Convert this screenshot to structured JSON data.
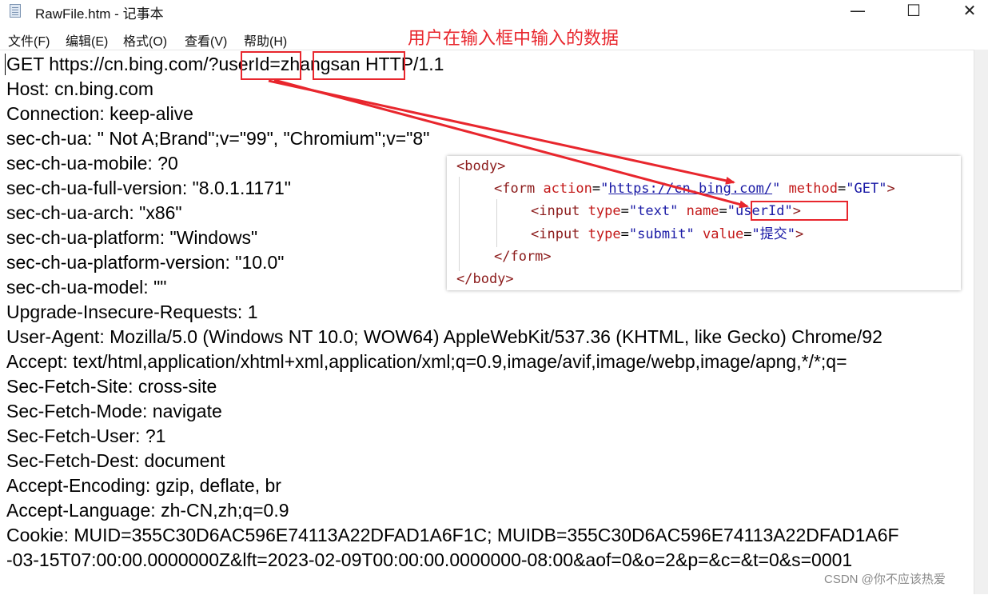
{
  "window": {
    "title": "RawFile.htm - 记事本",
    "controls": {
      "minimize": "—",
      "maximize": "☐",
      "close": "✕"
    }
  },
  "menu": [
    "文件(F)",
    "编辑(E)",
    "格式(O)",
    "查看(V)",
    "帮助(H)"
  ],
  "annotation": "用户在输入框中输入的数据",
  "request": {
    "first_line": {
      "prefix": "GET https://cn.bing.com/?",
      "param_name": "userId",
      "equals": "=",
      "param_value": "zhangsan",
      "suffix": " HTTP/1.1"
    },
    "lines": [
      "Host: cn.bing.com",
      "Connection: keep-alive",
      "sec-ch-ua: \" Not A;Brand\";v=\"99\", \"Chromium\";v=\"8\"",
      "sec-ch-ua-mobile: ?0",
      "sec-ch-ua-full-version: \"8.0.1.1171\"",
      "sec-ch-ua-arch: \"x86\"",
      "sec-ch-ua-platform: \"Windows\"",
      "sec-ch-ua-platform-version: \"10.0\"",
      "sec-ch-ua-model: \"\"",
      "Upgrade-Insecure-Requests: 1",
      "User-Agent: Mozilla/5.0 (Windows NT 10.0; WOW64) AppleWebKit/537.36 (KHTML, like Gecko) Chrome/92",
      "Accept: text/html,application/xhtml+xml,application/xml;q=0.9,image/avif,image/webp,image/apng,*/*;q=",
      "Sec-Fetch-Site: cross-site",
      "Sec-Fetch-Mode: navigate",
      "Sec-Fetch-User: ?1",
      "Sec-Fetch-Dest: document",
      "Accept-Encoding: gzip, deflate, br",
      "Accept-Language: zh-CN,zh;q=0.9",
      "Cookie: MUID=355C30D6AC596E74113A22DFAD1A6F1C; MUIDB=355C30D6AC596E74113A22DFAD1A6F",
      "-03-15T07:00:00.0000000Z&lft=2023-02-09T00:00:00.0000000-08:00&aof=0&o=2&p=&c=&t=0&s=0001"
    ]
  },
  "code_snippet": {
    "body_open": "<body>",
    "form": {
      "open": "<form",
      "action_attr": "action",
      "action_value": "https://cn.bing.com/",
      "method_attr": "method",
      "method_value": "GET",
      "close_bracket": ">"
    },
    "input1": {
      "open": "<input",
      "type_attr": "type",
      "type_value": "text",
      "name_attr": "name",
      "name_value": "userId",
      "close_bracket": ">"
    },
    "input2": {
      "open": "<input",
      "type_attr": "type",
      "type_value": "submit",
      "value_attr": "value",
      "value_value": "提交",
      "close_bracket": ">"
    },
    "form_close": "</form>",
    "body_close": "</body>"
  },
  "watermark": "CSDN @你不应该热爱",
  "colors": {
    "annotation": "#e8262d",
    "tag": "#8b1a1a",
    "attr": "#c31919",
    "value": "#1a1aa6"
  }
}
